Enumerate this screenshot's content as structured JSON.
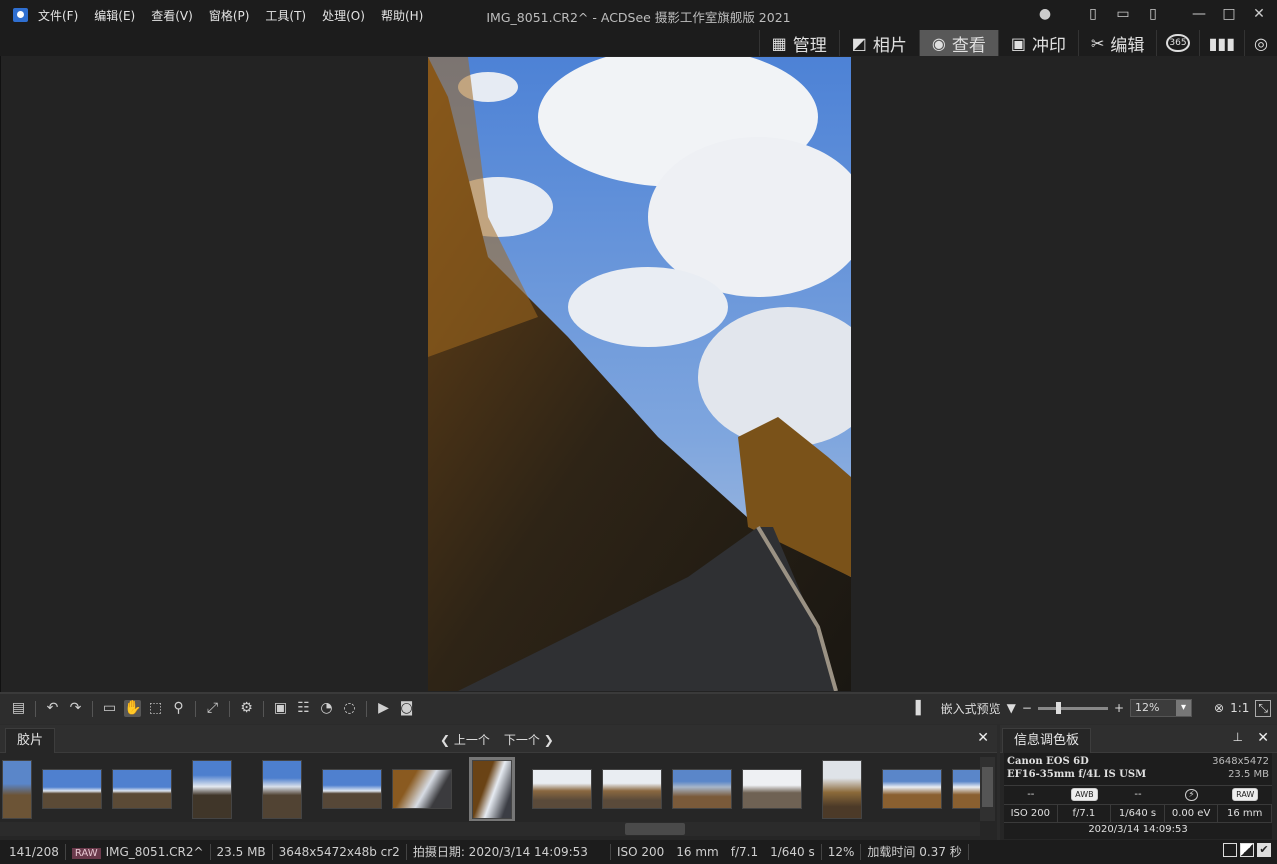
{
  "menu": [
    "文件(F)",
    "编辑(E)",
    "查看(V)",
    "窗格(P)",
    "工具(T)",
    "处理(O)",
    "帮助(H)"
  ],
  "window_title": "IMG_8051.CR2^ - ACDSee 摄影工作室旗舰版 2021",
  "modes": {
    "manage": "管理",
    "photos": "相片",
    "view": "查看",
    "develop": "冲印",
    "edit": "编辑",
    "m365": "365"
  },
  "toolbar": {
    "embedded_preview": "嵌入式预览",
    "zoom_value": "12%",
    "one_to_one": "1:1"
  },
  "filmstrip": {
    "tab": "胶片",
    "prev": "上一个",
    "next": "下一个"
  },
  "info_panel": {
    "tab": "信息调色板",
    "camera": "Canon EOS 6D",
    "lens": "EF16-35mm f/4L IS USM",
    "dimensions": "3648x5472",
    "size": "23.5 MB",
    "metering": "--",
    "wb": "AWB",
    "exposure_mode": "--",
    "flash": "⚡",
    "format": "RAW",
    "iso": "ISO 200",
    "aperture": "f/7.1",
    "shutter": "1/640 s",
    "ev": "0.00 eV",
    "focal": "16 mm",
    "datetime": "2020/3/14 14:09:53"
  },
  "status": {
    "count": "141/208",
    "raw": "RAW",
    "file": "IMG_8051.CR2^",
    "size": "23.5 MB",
    "dims": "3648x5472x48b cr2",
    "date": "拍摄日期: 2020/3/14 14:09:53",
    "iso": "ISO 200",
    "focal": "16 mm",
    "aperture": "f/7.1",
    "shutter": "1/640 s",
    "zoom": "12%",
    "load": "加载时间 0.37 秒"
  }
}
